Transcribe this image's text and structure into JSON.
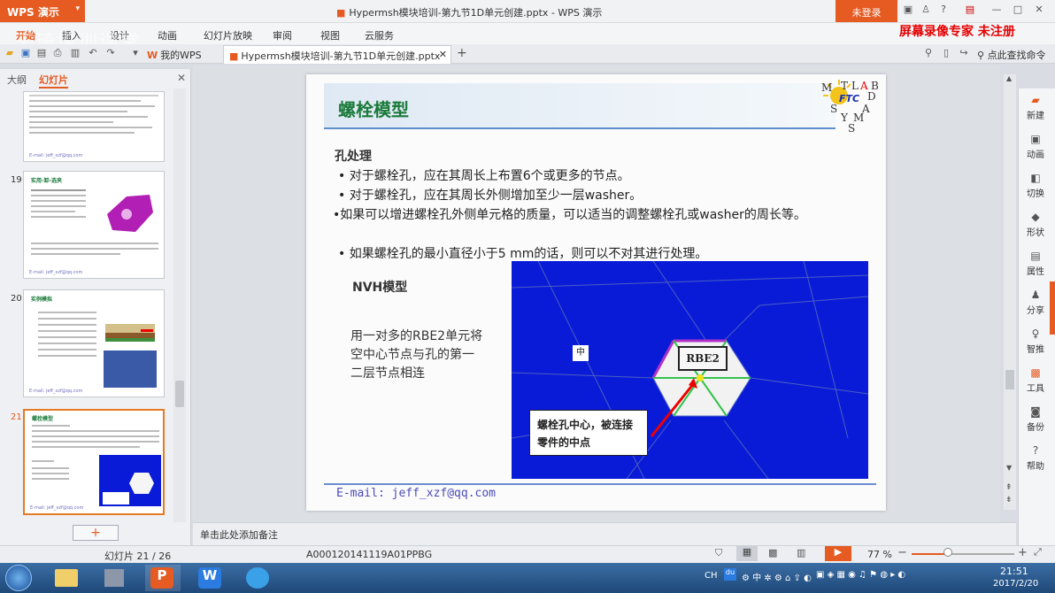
{
  "titlebar": {
    "app_button": "WPS 演示",
    "doc_title": "Hypermsh模块培训-第九节1D单元创建.pptx - WPS 演示",
    "login": "未登录"
  },
  "menu": {
    "items": [
      "开始",
      "插入",
      "设计",
      "动画",
      "幻灯片放映",
      "审阅",
      "视图",
      "云服务"
    ],
    "watermark": "天琦培训课堂",
    "rec_notice": "屏幕录像专家  未注册"
  },
  "tabs": {
    "mywps": "我的WPS",
    "doc": "Hypermsh模块培训-第九节1D单元创建.pptx",
    "search": "点此查找命令"
  },
  "leftpanel": {
    "tab_outline": "大纲",
    "tab_slides": "幻灯片",
    "thumbs": [
      {
        "num": "19",
        "title": "实用-卸-选夹"
      },
      {
        "num": "20",
        "title": "实例模拟"
      },
      {
        "num": "21",
        "title": "螺栓模型"
      }
    ],
    "thumb_footer": "E-mail: jeff_xzf@qq.com"
  },
  "slide": {
    "title": "螺栓模型",
    "logo": {
      "letters": [
        "M",
        "T",
        "L",
        "A",
        "B",
        "D",
        "S",
        "A",
        "Y",
        "M",
        "S"
      ],
      "brand": "FTC"
    },
    "heading": "孔处理",
    "bullets": [
      "• 对于螺栓孔，应在其周长上布置6个或更多的节点。",
      "• 对于螺栓孔，应在其周长外侧增加至少一层washer。",
      "•如果可以增进螺栓孔外侧单元格的质量，可以适当的调整螺栓孔或washer的周长等。",
      "• 如果螺栓孔的最小直径小于5 mm的话，则可以不对其进行处理。"
    ],
    "nvh_label": "NVH模型",
    "nvh_text": "用一对多的RBE2单元将空中心节点与孔的第一二层节点相连",
    "fig": {
      "rbe2": "RBE2",
      "center_mark": "中",
      "callout": "螺栓孔中心，被连接零件的中点"
    },
    "email": "E-mail: jeff_xzf@qq.com"
  },
  "notes": {
    "placeholder": "单击此处添加备注"
  },
  "rightbar": {
    "items": [
      "新建",
      "动画",
      "切换",
      "形状",
      "属性",
      "分享",
      "智推",
      "工具",
      "备份",
      "帮助"
    ]
  },
  "status": {
    "slide_count": "幻灯片 21 / 26",
    "template": "A000120141119A01PPBG",
    "zoom": "77 %"
  },
  "taskbar": {
    "time": "21:51",
    "date": "2017/2/20",
    "tray_lang": "CH"
  },
  "colors": {
    "wps_orange": "#e55b22",
    "slide_title_green": "#1a7a3a",
    "figure_blue": "#0a1bd8",
    "accent_red": "#e60000"
  }
}
